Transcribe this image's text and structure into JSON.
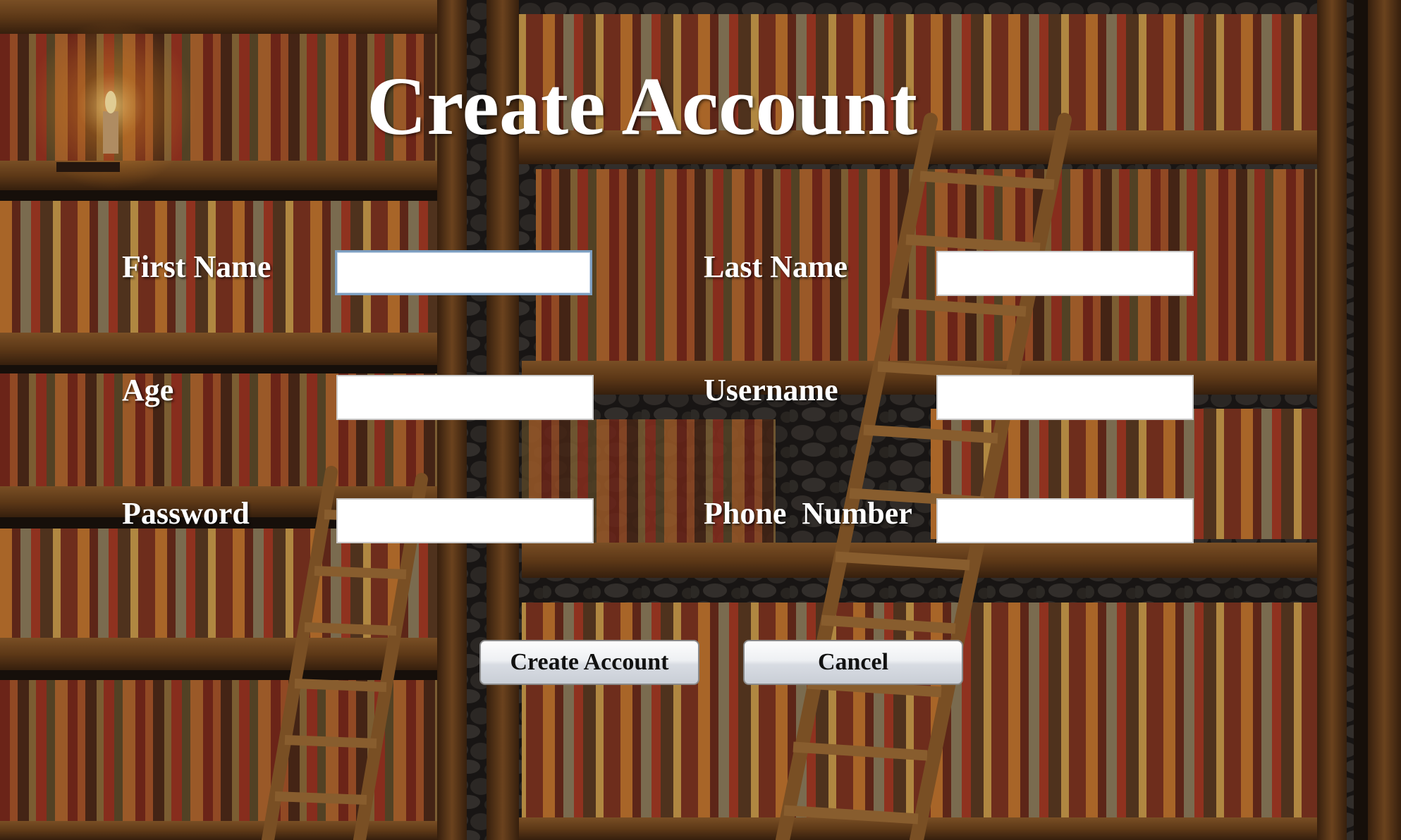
{
  "form": {
    "title": "Create Account",
    "fields": {
      "first_name": {
        "label": "First Name",
        "value": ""
      },
      "last_name": {
        "label": "Last Name",
        "value": ""
      },
      "age": {
        "label": "Age",
        "value": ""
      },
      "username": {
        "label": "Username",
        "value": ""
      },
      "password": {
        "label": "Password",
        "value": ""
      },
      "phone_number": {
        "label": "Phone  Number",
        "value": ""
      }
    },
    "buttons": {
      "create_label": "Create Account",
      "cancel_label": "Cancel"
    }
  },
  "colors": {
    "label_text": "#ffffff",
    "field_background": "#ffffff",
    "focused_field_border": "#7d9ec0",
    "button_text": "#111111",
    "background_wood": "#5a3416",
    "background_dark": "#1a120c"
  }
}
